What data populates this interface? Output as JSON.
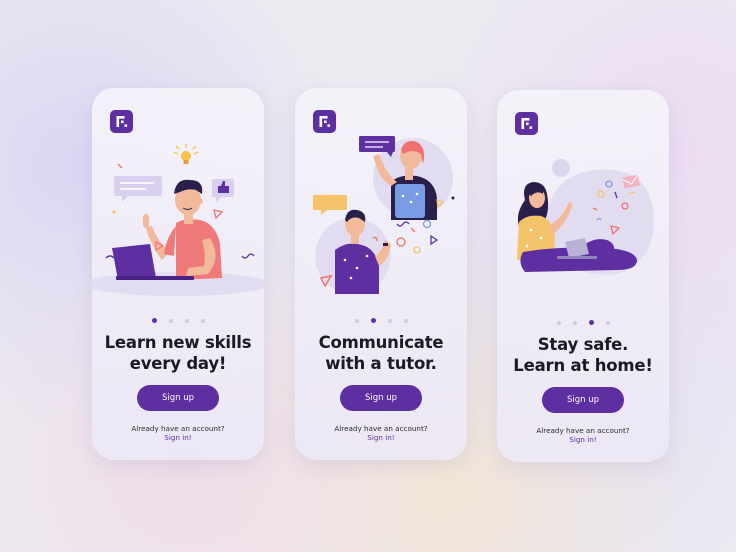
{
  "colors": {
    "brand": "#5d2fa0",
    "skin": "#f2b99a",
    "accent_coral": "#f07070"
  },
  "screens": [
    {
      "title_line1": "Learn new skills",
      "title_line2": "every day!",
      "button_label": "Sign up",
      "account_prompt": "Already have an account?",
      "signin_link": "Sign in!",
      "page_index": 1,
      "page_count": 4
    },
    {
      "title_line1": "Communicate",
      "title_line2": "with a tutor.",
      "button_label": "Sign up",
      "account_prompt": "Already have an account?",
      "signin_link": "Sign in!",
      "page_index": 2,
      "page_count": 4
    },
    {
      "title_line1": "Stay safe.",
      "title_line2": "Learn at home!",
      "button_label": "Sign up",
      "account_prompt": "Already have an account?",
      "signin_link": "Sign in!",
      "page_index": 3,
      "page_count": 4
    }
  ]
}
